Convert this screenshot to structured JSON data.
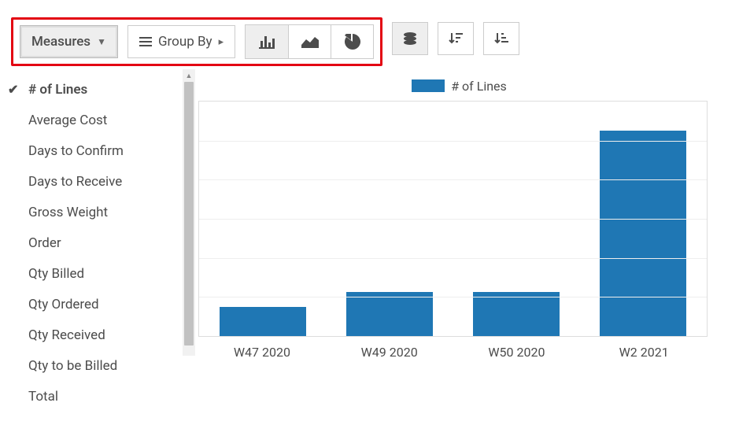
{
  "toolbar": {
    "measures_label": "Measures",
    "groupby_label": "Group By"
  },
  "measures_menu": {
    "items": [
      {
        "label": "# of Lines",
        "selected": true
      },
      {
        "label": "Average Cost",
        "selected": false
      },
      {
        "label": "Days to Confirm",
        "selected": false
      },
      {
        "label": "Days to Receive",
        "selected": false
      },
      {
        "label": "Gross Weight",
        "selected": false
      },
      {
        "label": "Order",
        "selected": false
      },
      {
        "label": "Qty Billed",
        "selected": false
      },
      {
        "label": "Qty Ordered",
        "selected": false
      },
      {
        "label": "Qty Received",
        "selected": false
      },
      {
        "label": "Qty to be Billed",
        "selected": false
      },
      {
        "label": "Total",
        "selected": false
      }
    ]
  },
  "legend": {
    "label": "# of Lines"
  },
  "chart_data": {
    "type": "bar",
    "categories": [
      "W47 2020",
      "W49 2020",
      "W50 2020",
      "W2 2021"
    ],
    "values": [
      1,
      1.5,
      1.5,
      7
    ],
    "title": "",
    "xlabel": "",
    "ylabel": "",
    "ylim": [
      0,
      8
    ],
    "series_name": "# of Lines",
    "color": "#1f77b4"
  }
}
